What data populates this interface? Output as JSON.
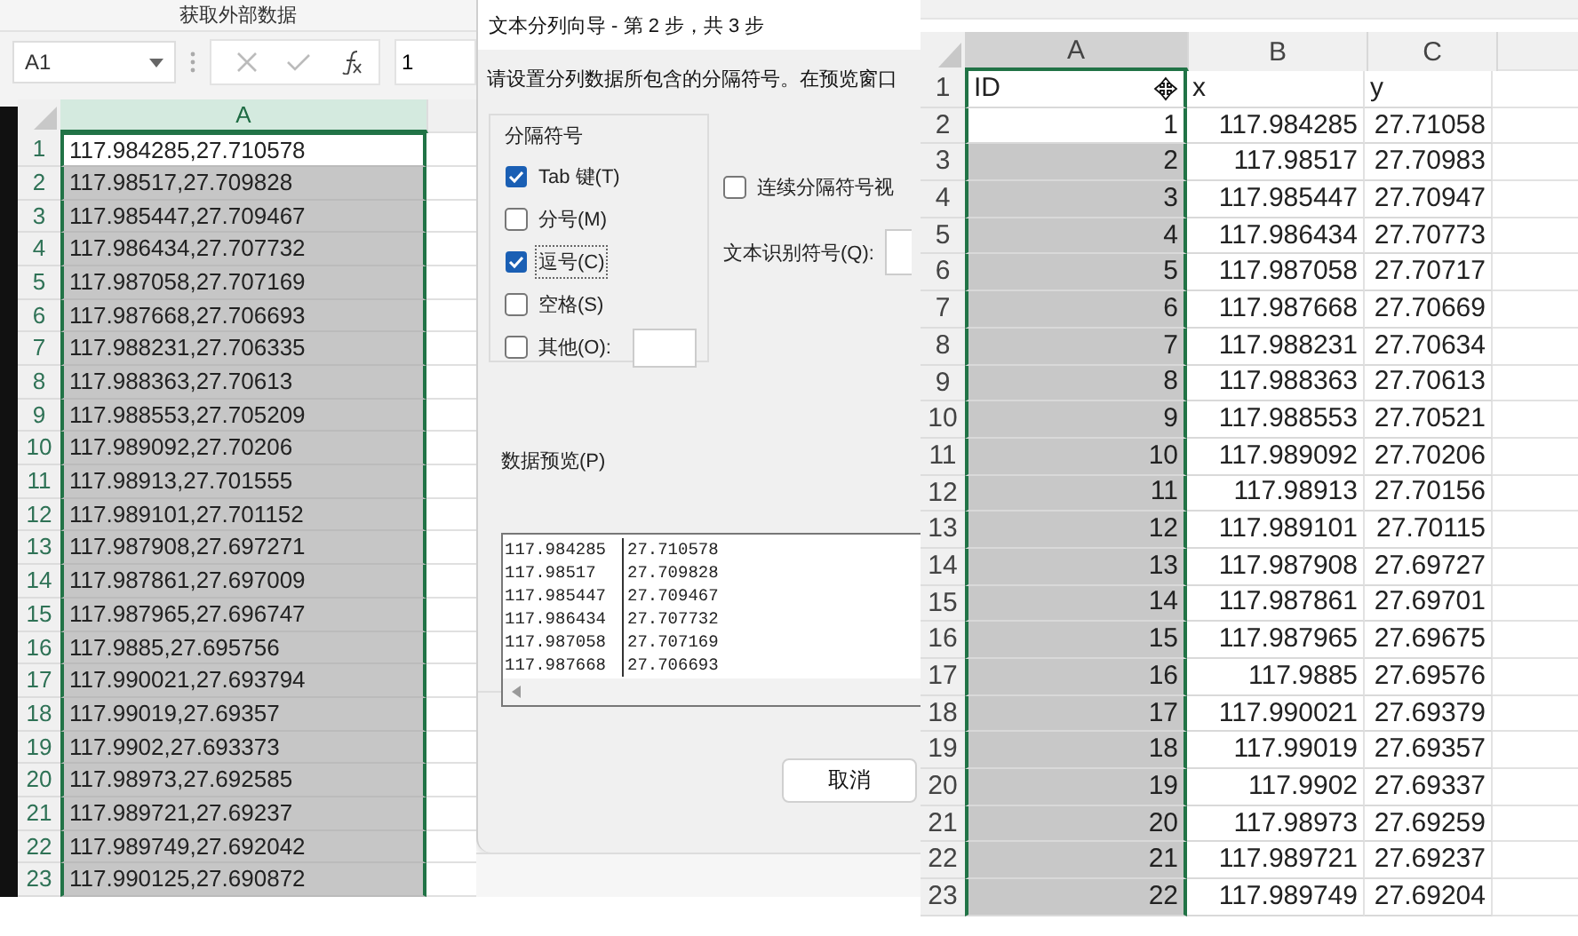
{
  "left_window": {
    "ribbon_group_label": "获取外部数据",
    "name_box": "A1",
    "formula_value": "1",
    "sheet": {
      "columns": [
        {
          "label": "A",
          "selected": true
        }
      ],
      "rows": [
        {
          "number": "1",
          "cells": [
            "117.984285,27.710578"
          ],
          "active": true
        },
        {
          "number": "2",
          "cells": [
            "117.98517,27.709828"
          ],
          "active": false
        },
        {
          "number": "3",
          "cells": [
            "117.985447,27.709467"
          ],
          "active": false
        },
        {
          "number": "4",
          "cells": [
            "117.986434,27.707732"
          ],
          "active": false
        },
        {
          "number": "5",
          "cells": [
            "117.987058,27.707169"
          ],
          "active": false
        },
        {
          "number": "6",
          "cells": [
            "117.987668,27.706693"
          ],
          "active": false
        },
        {
          "number": "7",
          "cells": [
            "117.988231,27.706335"
          ],
          "active": false
        },
        {
          "number": "8",
          "cells": [
            "117.988363,27.70613"
          ],
          "active": false
        },
        {
          "number": "9",
          "cells": [
            "117.988553,27.705209"
          ],
          "active": false
        },
        {
          "number": "10",
          "cells": [
            "117.989092,27.70206"
          ],
          "active": false
        },
        {
          "number": "11",
          "cells": [
            "117.98913,27.701555"
          ],
          "active": false
        },
        {
          "number": "12",
          "cells": [
            "117.989101,27.701152"
          ],
          "active": false
        },
        {
          "number": "13",
          "cells": [
            "117.987908,27.697271"
          ],
          "active": false
        },
        {
          "number": "14",
          "cells": [
            "117.987861,27.697009"
          ],
          "active": false
        },
        {
          "number": "15",
          "cells": [
            "117.987965,27.696747"
          ],
          "active": false
        },
        {
          "number": "16",
          "cells": [
            "117.9885,27.695756"
          ],
          "active": false
        },
        {
          "number": "17",
          "cells": [
            "117.990021,27.693794"
          ],
          "active": false
        },
        {
          "number": "18",
          "cells": [
            "117.99019,27.69357"
          ],
          "active": false
        },
        {
          "number": "19",
          "cells": [
            "117.9902,27.693373"
          ],
          "active": false
        },
        {
          "number": "20",
          "cells": [
            "117.98973,27.692585"
          ],
          "active": false
        },
        {
          "number": "21",
          "cells": [
            "117.989721,27.69237"
          ],
          "active": false
        },
        {
          "number": "22",
          "cells": [
            "117.989749,27.692042"
          ],
          "active": false
        },
        {
          "number": "23",
          "cells": [
            "117.990125,27.690872"
          ],
          "active": false
        }
      ]
    }
  },
  "dialog": {
    "title": "文本分列向导 - 第 2 步，共 3 步",
    "instruction": "请设置分列数据所包含的分隔符号。在预览窗口",
    "delimiters": {
      "label": "分隔符号",
      "options": [
        {
          "label": "Tab 键(T)",
          "checked": true,
          "focused": false,
          "kind": "plain"
        },
        {
          "label": "分号(M)",
          "checked": false,
          "focused": false,
          "kind": "plain"
        },
        {
          "label": "逗号(C)",
          "checked": true,
          "focused": true,
          "kind": "plain"
        },
        {
          "label": "空格(S)",
          "checked": false,
          "focused": false,
          "kind": "plain"
        },
        {
          "label": "其他(O):",
          "checked": false,
          "focused": false,
          "kind": "field"
        }
      ]
    },
    "consecutive": {
      "label": "连续分隔符号视",
      "checked": false
    },
    "qualifier": {
      "label": "文本识别符号(Q):"
    },
    "preview": {
      "label": "数据预览(P)",
      "rows": [
        [
          "117.984285",
          "27.710578"
        ],
        [
          "117.98517",
          "27.709828"
        ],
        [
          "117.985447",
          "27.709467"
        ],
        [
          "117.986434",
          "27.707732"
        ],
        [
          "117.987058",
          "27.707169"
        ],
        [
          "117.987668",
          "27.706693"
        ]
      ]
    },
    "buttons": [
      "取消"
    ]
  },
  "right_window": {
    "sheet": {
      "columns": [
        {
          "label": "A",
          "selected": true
        },
        {
          "label": "B",
          "selected": false
        },
        {
          "label": "C",
          "selected": false
        }
      ],
      "rows": [
        {
          "number": "1",
          "kind": "header",
          "cells": [
            "ID",
            "x",
            "y"
          ]
        },
        {
          "number": "2",
          "kind": "number",
          "cells": [
            "1",
            "117.984285",
            "27.71058"
          ],
          "active": true
        },
        {
          "number": "3",
          "kind": "number",
          "cells": [
            "2",
            "117.98517",
            "27.70983"
          ],
          "active": false
        },
        {
          "number": "4",
          "kind": "number",
          "cells": [
            "3",
            "117.985447",
            "27.70947"
          ],
          "active": false
        },
        {
          "number": "5",
          "kind": "number",
          "cells": [
            "4",
            "117.986434",
            "27.70773"
          ],
          "active": false
        },
        {
          "number": "6",
          "kind": "number",
          "cells": [
            "5",
            "117.987058",
            "27.70717"
          ],
          "active": false
        },
        {
          "number": "7",
          "kind": "number",
          "cells": [
            "6",
            "117.987668",
            "27.70669"
          ],
          "active": false
        },
        {
          "number": "8",
          "kind": "number",
          "cells": [
            "7",
            "117.988231",
            "27.70634"
          ],
          "active": false
        },
        {
          "number": "9",
          "kind": "number",
          "cells": [
            "8",
            "117.988363",
            "27.70613"
          ],
          "active": false
        },
        {
          "number": "10",
          "kind": "number",
          "cells": [
            "9",
            "117.988553",
            "27.70521"
          ],
          "active": false
        },
        {
          "number": "11",
          "kind": "number",
          "cells": [
            "10",
            "117.989092",
            "27.70206"
          ],
          "active": false
        },
        {
          "number": "12",
          "kind": "number",
          "cells": [
            "11",
            "117.98913",
            "27.70156"
          ],
          "active": false
        },
        {
          "number": "13",
          "kind": "number",
          "cells": [
            "12",
            "117.989101",
            "27.70115"
          ],
          "active": false
        },
        {
          "number": "14",
          "kind": "number",
          "cells": [
            "13",
            "117.987908",
            "27.69727"
          ],
          "active": false
        },
        {
          "number": "15",
          "kind": "number",
          "cells": [
            "14",
            "117.987861",
            "27.69701"
          ],
          "active": false
        },
        {
          "number": "16",
          "kind": "number",
          "cells": [
            "15",
            "117.987965",
            "27.69675"
          ],
          "active": false
        },
        {
          "number": "17",
          "kind": "number",
          "cells": [
            "16",
            "117.9885",
            "27.69576"
          ],
          "active": false
        },
        {
          "number": "18",
          "kind": "number",
          "cells": [
            "17",
            "117.990021",
            "27.69379"
          ],
          "active": false
        },
        {
          "number": "19",
          "kind": "number",
          "cells": [
            "18",
            "117.99019",
            "27.69357"
          ],
          "active": false
        },
        {
          "number": "20",
          "kind": "number",
          "cells": [
            "19",
            "117.9902",
            "27.69337"
          ],
          "active": false
        },
        {
          "number": "21",
          "kind": "number",
          "cells": [
            "20",
            "117.98973",
            "27.69259"
          ],
          "active": false
        },
        {
          "number": "22",
          "kind": "number",
          "cells": [
            "21",
            "117.989721",
            "27.69237"
          ],
          "active": false
        },
        {
          "number": "23",
          "kind": "number",
          "cells": [
            "22",
            "117.989749",
            "27.69204"
          ],
          "active": false
        }
      ]
    }
  }
}
